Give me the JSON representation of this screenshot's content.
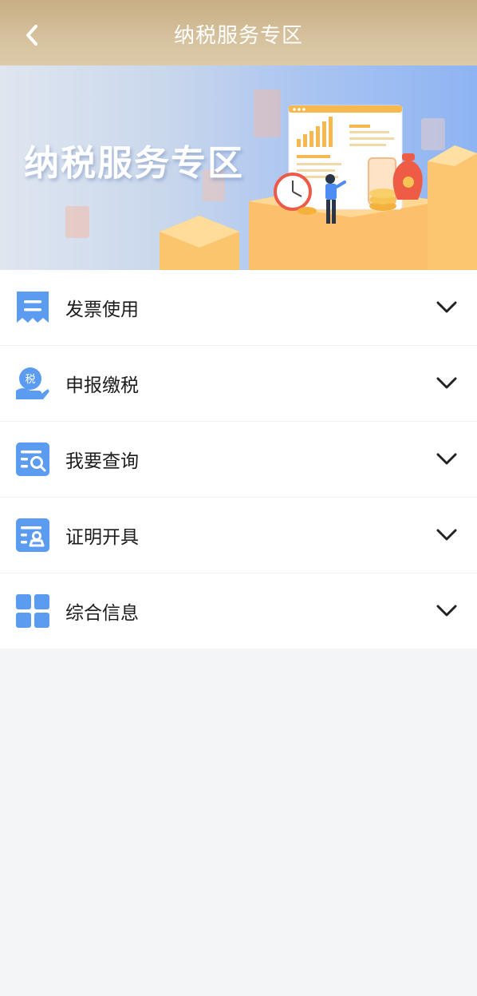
{
  "header": {
    "title": "纳税服务专区",
    "back_icon": "chevron-left-icon"
  },
  "banner": {
    "title": "纳税服务专区"
  },
  "menu": {
    "items": [
      {
        "label": "发票使用",
        "icon": "invoice-icon"
      },
      {
        "label": "申报缴税",
        "icon": "tax-payment-icon"
      },
      {
        "label": "我要查询",
        "icon": "query-icon"
      },
      {
        "label": "证明开具",
        "icon": "certificate-icon"
      },
      {
        "label": "综合信息",
        "icon": "grid-icon"
      }
    ],
    "expand_icon": "chevron-down-icon"
  },
  "colors": {
    "header_bg": "#cdb58c",
    "icon_blue": "#5b9cf0",
    "page_bg": "#f4f5f7"
  }
}
